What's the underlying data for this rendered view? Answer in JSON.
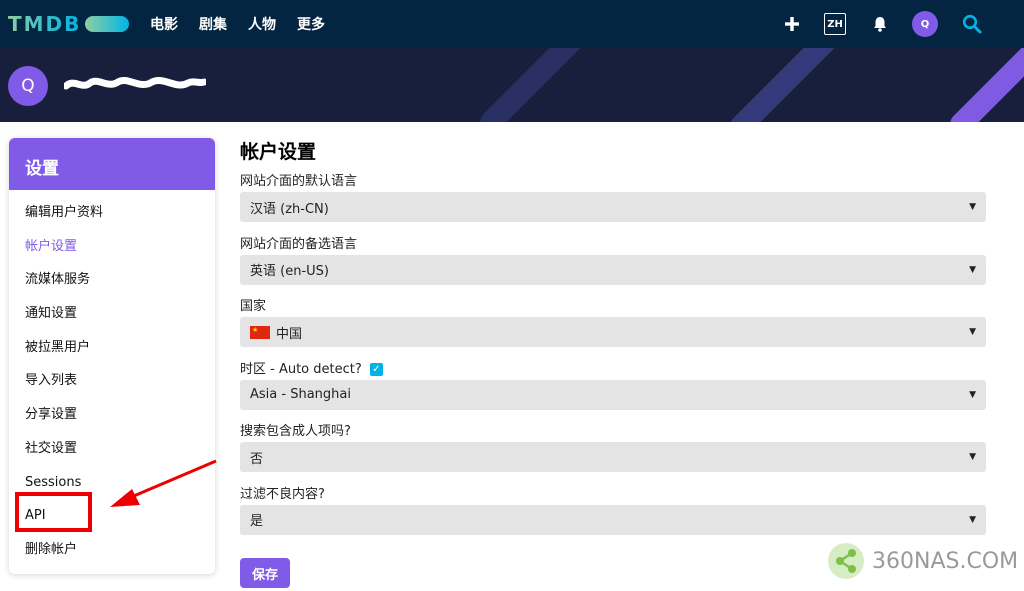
{
  "header": {
    "logo_text": "TMDB",
    "nav": [
      "电影",
      "剧集",
      "人物",
      "更多"
    ],
    "lang_label": "ZH",
    "avatar_letter": "Q"
  },
  "banner": {
    "avatar_letter": "Q"
  },
  "sidebar": {
    "title": "设置",
    "items": [
      {
        "label": "编辑用户资料",
        "active": false
      },
      {
        "label": "帐户设置",
        "active": true
      },
      {
        "label": "流媒体服务",
        "active": false
      },
      {
        "label": "通知设置",
        "active": false
      },
      {
        "label": "被拉黑用户",
        "active": false
      },
      {
        "label": "导入列表",
        "active": false
      },
      {
        "label": "分享设置",
        "active": false
      },
      {
        "label": "社交设置",
        "active": false
      },
      {
        "label": "Sessions",
        "active": false
      },
      {
        "label": "API",
        "active": false
      },
      {
        "label": "删除帐户",
        "active": false
      }
    ]
  },
  "main": {
    "title": "帐户设置",
    "fields": [
      {
        "label": "网站介面的默认语言",
        "value": "汉语 (zh-CN)"
      },
      {
        "label": "网站介面的备选语言",
        "value": "英语 (en-US)"
      },
      {
        "label": "国家",
        "value": "中国"
      },
      {
        "label": "时区 - Auto detect?",
        "value": "Asia - Shanghai"
      },
      {
        "label": "搜索包含成人项吗?",
        "value": "否"
      },
      {
        "label": "过滤不良内容?",
        "value": "是"
      }
    ],
    "save_label": "保存"
  },
  "watermark": {
    "text": "360NAS.COM"
  },
  "colors": {
    "nav_bg": "#032541",
    "accent": "#805be7",
    "banner_bg": "#181f3d",
    "checkbox": "#01b4e4",
    "annotation_red": "#ee0000"
  }
}
